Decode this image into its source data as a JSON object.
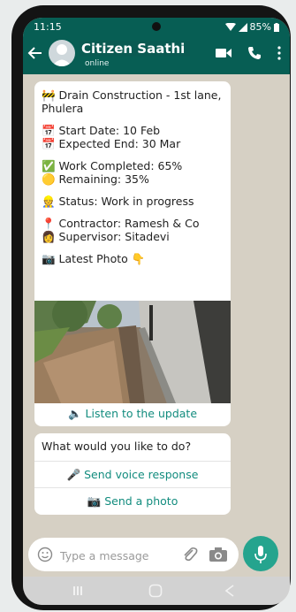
{
  "status_bar": {
    "time": "11:15",
    "battery": "85%"
  },
  "header": {
    "title": "Citizen Saathi",
    "subtitle": "online"
  },
  "message": {
    "lines": [
      "🚧 Drain Construction - 1st lane,",
      "Phulera",
      "",
      "📅 Start Date: 10 Feb",
      "📅 Expected End: 30 Mar",
      "",
      "✅ Work Completed: 65%",
      "🟡 Remaining: 35%",
      "",
      "👷 Status: Work in progress",
      "",
      "📍 Contractor: Ramesh & Co",
      "👩 Supervisor: Sitadevi",
      "",
      "📷 Latest Photo 👇"
    ],
    "listen_label": "🔈 Listen to the update"
  },
  "actions": {
    "question": "What would you like to do?",
    "voice_label": "🎤 Send voice response",
    "photo_label": "📷 Send a photo"
  },
  "composer": {
    "placeholder": "Type a message"
  },
  "colors": {
    "header": "#075e54",
    "accent": "#128c7e",
    "mic": "#25a48e",
    "chat_bg": "#d6d0c4"
  }
}
